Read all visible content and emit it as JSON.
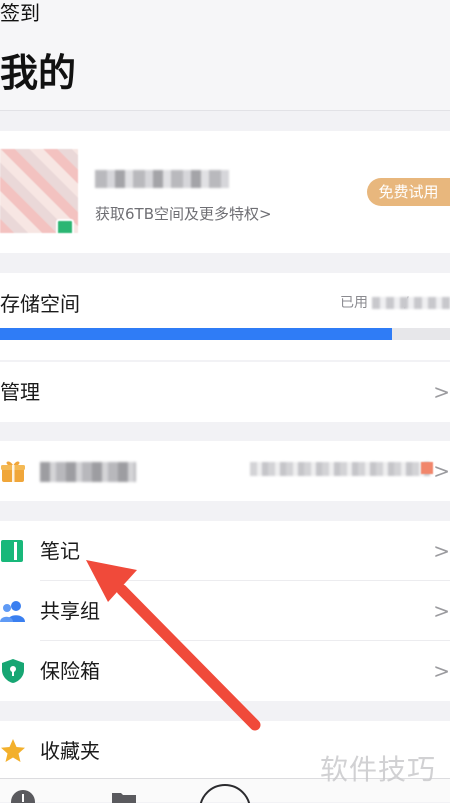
{
  "header": {
    "checkin_label": "签到",
    "title": "我的"
  },
  "profile": {
    "promo_text": "获取6TB空间及更多特权>",
    "trial_button": "免费试用"
  },
  "storage": {
    "label": "存储空间",
    "used_prefix": "已用",
    "used_separator": "/",
    "usage_fraction": 0.87,
    "bar_color": "#2f7cf6"
  },
  "menu": {
    "manage": "管理",
    "notes": "笔记",
    "share_group": "共享组",
    "safe_box": "保险箱",
    "favorites": "收藏夹",
    "chevron": ">"
  },
  "watermark": "软件技巧",
  "colors": {
    "gift_icon": "#f0a63a",
    "notes_icon": "#18b87a",
    "share_icon": "#3a7ff0",
    "safe_icon": "#17a673",
    "favorites_icon": "#f3b02c",
    "annotation_arrow": "#f04a3a"
  }
}
